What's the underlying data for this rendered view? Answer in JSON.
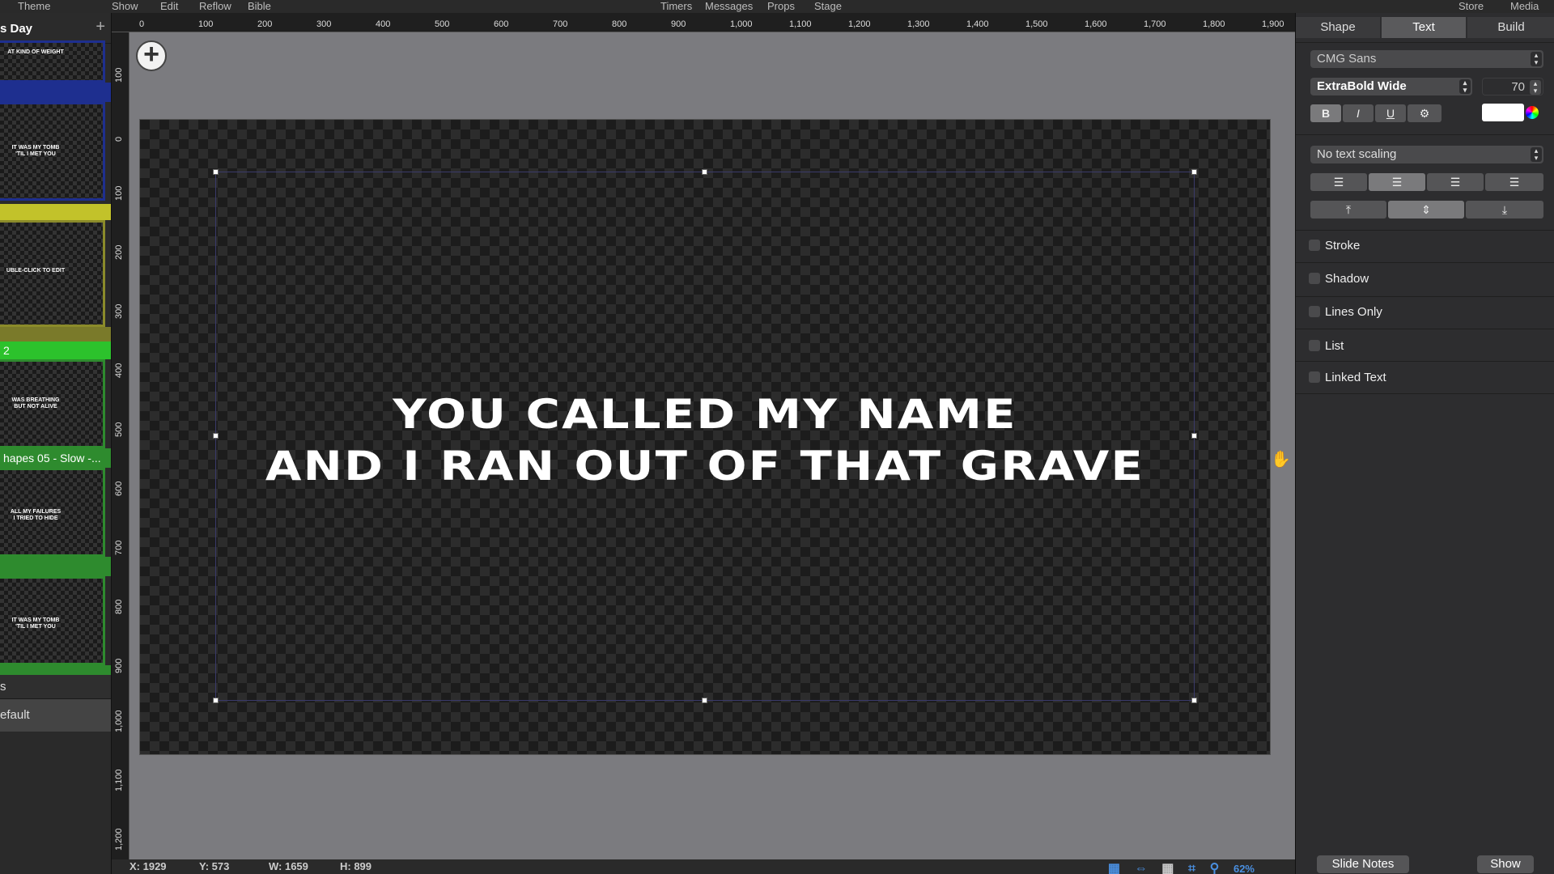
{
  "menu": {
    "theme": "Theme",
    "show": "Show",
    "edit": "Edit",
    "reflow": "Reflow",
    "bible": "Bible",
    "timers": "Timers",
    "messages": "Messages",
    "props": "Props",
    "stage": "Stage",
    "store": "Store",
    "media": "Media"
  },
  "sidebar": {
    "title": "s Day",
    "add_icon": "+",
    "slides": [
      {
        "text": "AT KIND OF WEIGHT",
        "color": "#1e2f8f"
      },
      {
        "text": "IT WAS MY TOMB\n'TIL I MET YOU",
        "color": "#1e2f8f"
      },
      {
        "text": "UBLE-CLICK TO EDIT",
        "color": "#8b8b2a"
      },
      {
        "text": "WAS BREATHING\nBUT NOT ALIVE",
        "color": "#2e8b2e"
      },
      {
        "text": "ALL MY FAILURES\nI TRIED TO HIDE",
        "color": "#2e8b2e"
      },
      {
        "text": "IT WAS MY TOMB\n'TIL I MET YOU",
        "color": "#2e8b2e"
      }
    ],
    "band_2_label": "2",
    "shapes_label": "hapes 05 - Slow -...",
    "item_s": "s",
    "item_default": "efault"
  },
  "ruler": {
    "top": [
      "0",
      "100",
      "200",
      "300",
      "400",
      "500",
      "600",
      "700",
      "800",
      "900",
      "1,000",
      "1,100",
      "1,200",
      "1,300",
      "1,400",
      "1,500",
      "1,600",
      "1,700",
      "1,800",
      "1,900"
    ],
    "left": [
      "100",
      "0",
      "100",
      "200",
      "300",
      "400",
      "500",
      "600",
      "700",
      "800",
      "900",
      "1,000",
      "1,100",
      "1,200"
    ]
  },
  "canvas": {
    "add_button": "+",
    "slide_text": "YOU CALLED MY NAME\nAND I RAN OUT OF THAT GRAVE"
  },
  "status": {
    "x": "X: 1929",
    "y": "Y: 573",
    "w": "W: 1659",
    "h": "H: 899",
    "zoom": "62%"
  },
  "inspector": {
    "tabs": [
      "Shape",
      "Text",
      "Build"
    ],
    "font_family": "CMG Sans",
    "font_style": "ExtraBold Wide",
    "font_size": "70",
    "bold": "B",
    "italic": "I",
    "underline": "U",
    "gear": "⚙︎",
    "text_color": "#ffffff",
    "scaling": "No text scaling",
    "options": [
      "Stroke",
      "Shadow",
      "Lines Only",
      "List",
      "Linked Text"
    ],
    "slide_notes": "Slide Notes",
    "show": "Show"
  }
}
